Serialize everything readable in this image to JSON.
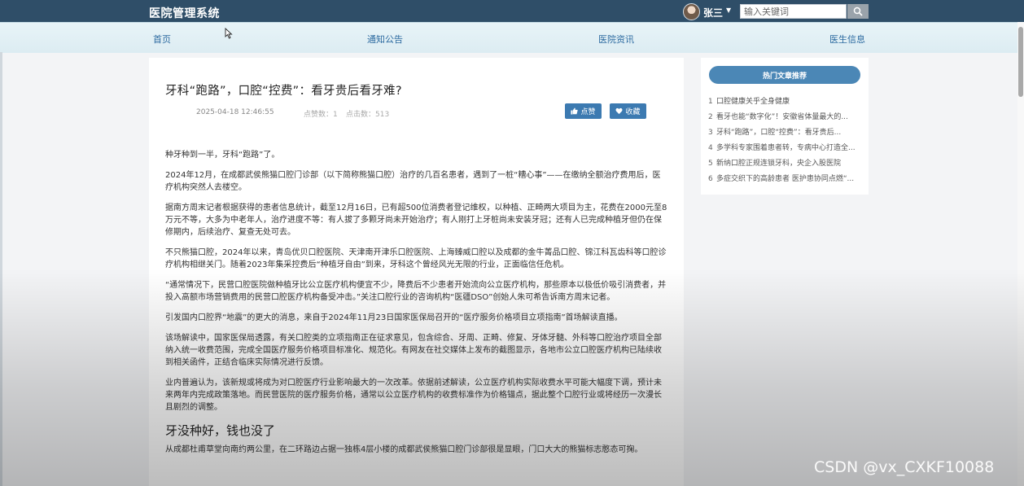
{
  "header": {
    "brand": "医院管理系统",
    "username": "张三",
    "search_placeholder": "输入关键词"
  },
  "nav": [
    "首页",
    "通知公告",
    "医院资讯",
    "医生信息"
  ],
  "article": {
    "title": "牙科“跑路”，口腔“控费”：看牙贵后看牙难?",
    "date": "2025-04-18 12:46:55",
    "likes": "点赞数：1",
    "views": "点击数：513",
    "like_button": "点赞",
    "fav_button": "收藏",
    "paragraphs": [
      "种牙种到一半，牙科“跑路”了。",
      "2024年12月，在成都武侯熊猫口腔门诊部（以下简称熊猫口腔）治疗的几百名患者，遇到了一桩“糟心事”——在缴纳全额治疗费用后，医疗机构突然人去楼空。",
      "据南方周末记者根据获得的患者信息统计，截至12月16日，已有超500位消费者登记维权，以种植、正畸两大项目为主，花费在2000元至8万元不等，大多为中老年人，治疗进度不等：有人拔了多颗牙尚未开始治疗；有人刚打上牙桩尚未安装牙冠；还有人已完成种植牙但仍在保修期内，后续治疗、复查无处可去。",
      "不只熊猫口腔，2024年以来，青岛优贝口腔医院、天津南开津乐口腔医院、上海臻威口腔以及成都的金牛菁品口腔、锦江科瓦齿科等口腔诊疗机构相继关门。随着2023年集采控费后“种植牙自由”到来，牙科这个曾经风光无限的行业，正面临信任危机。",
      "“通常情况下，民营口腔医院做种植牙比公立医疗机构便宜不少，降费后不少患者开始流向公立医疗机构，那些原本以极低价吸引消费者，并投入高额市场营销费用的民营口腔医疗机构备受冲击。”关注口腔行业的咨询机构“医疆DSO”创始人朱可希告诉南方周末记者。",
      "引发国内口腔界“地震”的更大的消息，来自于2024年11月23日国家医保局召开的“医疗服务价格项目立项指南”首场解读直播。",
      "该场解读中，国家医保局透露，有关口腔类的立项指南正在征求意见，包含综合、牙周、正畸、修复、牙体牙髓、外科等口腔治疗项目全部纳入统一收费范围，完成全国医疗服务价格项目标准化、规范化。有网友在社交媒体上发布的截图显示，各地市公立口腔医疗机构已陆续收到相关函件，正结合临床实际情况进行反馈。",
      "业内普遍认为，该新规或将成为对口腔医疗行业影响最大的一次改革。依据前述解读，公立医疗机构实际收费水平可能大幅度下调，预计未来两年内完成政策落地。而民营医院的医疗服务价格，通常以公立医疗机构的收费标准作为价格锚点，据此整个口腔行业或将经历一次漫长且剧烈的调整。"
    ],
    "subheading": "牙没种好，钱也没了",
    "last_paragraph": "从成都杜甫草堂向南约两公里，在二环路边占据一独栋4层小楼的成都武侯熊猫口腔门诊部很是显眼，门口大大的熊猫标志憨态可掬。"
  },
  "sidebar": {
    "heading": "热门文章推荐",
    "items": [
      {
        "num": "1",
        "title": "口腔健康关乎全身健康"
      },
      {
        "num": "2",
        "title": "看牙也能“数字化”！安徽省体量最大的..."
      },
      {
        "num": "3",
        "title": "牙科“跑路”，口腔“控费”：看牙贵后..."
      },
      {
        "num": "4",
        "title": "多学科专家围着患者转，专病中心打造全..."
      },
      {
        "num": "5",
        "title": "新纳口腔正规连锁牙科，央企入股医院"
      },
      {
        "num": "6",
        "title": "多症交织下的高龄患者 医护患协同点燃“..."
      }
    ]
  },
  "watermark": "CSDN @vx_CXKF10088",
  "colors": {
    "topbar": "#2f4e68",
    "nav_text": "#2c6aa0",
    "button": "#3c7ab1",
    "sidebar_head": "#4b87b6"
  }
}
